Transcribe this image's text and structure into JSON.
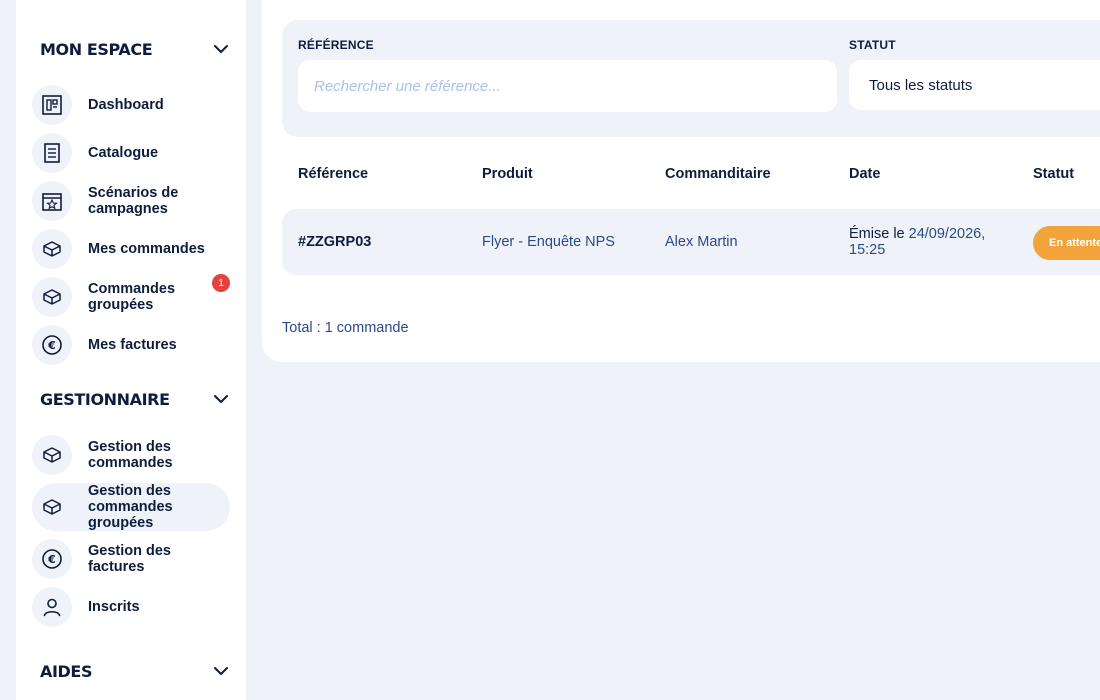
{
  "sidebar": {
    "sections": [
      {
        "title": "MON ESPACE",
        "items": [
          {
            "label": "Dashboard",
            "icon": "dashboard-icon"
          },
          {
            "label": "Catalogue",
            "icon": "catalogue-icon"
          },
          {
            "label": "Scénarios de campagnes",
            "icon": "calendar-star-icon"
          },
          {
            "label": "Mes commandes",
            "icon": "box-icon"
          },
          {
            "label": "Commandes groupées",
            "icon": "box-icon",
            "badge": "1"
          },
          {
            "label": "Mes factures",
            "icon": "euro-icon"
          }
        ]
      },
      {
        "title": "GESTIONNAIRE",
        "items": [
          {
            "label": "Gestion des commandes",
            "icon": "box-icon"
          },
          {
            "label": "Gestion des commandes groupées",
            "icon": "box-icon",
            "active": true
          },
          {
            "label": "Gestion des factures",
            "icon": "euro-icon"
          },
          {
            "label": "Inscrits",
            "icon": "user-icon"
          }
        ]
      },
      {
        "title": "AIDES",
        "items": []
      }
    ]
  },
  "filters": {
    "reference_label": "RÉFÉRENCE",
    "reference_placeholder": "Rechercher une référence...",
    "status_label": "STATUT",
    "status_value": "Tous les statuts"
  },
  "table": {
    "headers": [
      "Référence",
      "Produit",
      "Commanditaire",
      "Date",
      "Statut"
    ],
    "rows": [
      {
        "reference": "#ZZGRP03",
        "product": "Flyer - Enquête NPS",
        "client": "Alex Martin",
        "date_prefix": "Émise le",
        "date_value": "24/09/2026,",
        "time_value": "15:25",
        "status": "En attente"
      }
    ]
  },
  "total": "Total : 1 commande",
  "colors": {
    "background": "#eff2f9",
    "text": "#0e1d3e",
    "link": "#2a4a88",
    "badge": "#e5423c",
    "status_pending": "#f2a43a"
  }
}
